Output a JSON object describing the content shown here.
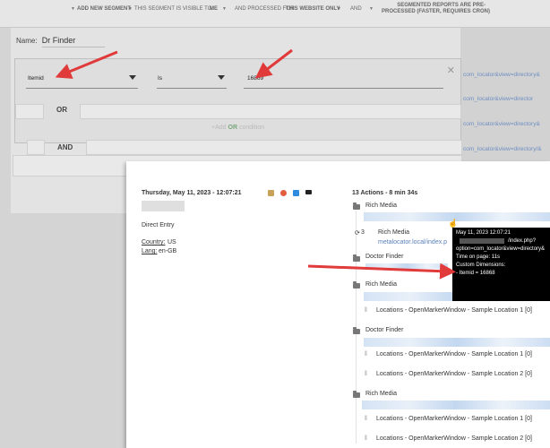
{
  "toolbar": {
    "add_segment": "ADD NEW SEGMENT",
    "visible_to_label": "THIS SEGMENT IS VISIBLE TO:",
    "visible_to_value": "ME",
    "processed_label": "AND PROCESSED FOR",
    "processed_value": "THIS WEBSITE ONLY",
    "and_label": "AND",
    "reports_line1": "SEGMENTED REPORTS ARE PRE-",
    "reports_line2": "PROCESSED (FASTER, REQUIRES CRON)"
  },
  "segment": {
    "name_label": "Name:",
    "name_value": "Dr Finder",
    "dimension": "Itemid",
    "operator": "Is",
    "value": "16869",
    "or_label": "OR",
    "add_or_prefix": "+Add ",
    "add_or_em": "OR",
    "add_or_suffix": " condition",
    "and_label": "AND"
  },
  "link_fragments": [
    "com_locator&view=directory&",
    "com_locator&view=director",
    "com_locator&view=directory&",
    "com_locator&view=directory/&"
  ],
  "visit": {
    "datetime": "Thursday, May 11, 2023 - 12:07:21",
    "referrer": "Direct Entry",
    "country_label": "Country:",
    "country": "US",
    "lang_label": "Lang:",
    "lang": "en-GB",
    "actions_summary": "13 Actions - 8 min 34s",
    "actions": [
      {
        "title": "Rich Media"
      },
      {
        "title": "Rich Media",
        "prefix": "3",
        "link": "metalocator.local/index.p"
      },
      {
        "title": "Doctor Finder"
      },
      {
        "title": "Rich Media"
      },
      {
        "event": "Locations - OpenMarkerWindow - Sample Location 1 [0]"
      },
      {
        "title": "Doctor Finder"
      },
      {
        "event": "Locations - OpenMarkerWindow - Sample Location 1 [0]"
      },
      {
        "event": "Locations - OpenMarkerWindow - Sample Location 2 [0]"
      },
      {
        "title": "Rich Media"
      },
      {
        "event": "Locations - OpenMarkerWindow - Sample Location 1 [0]"
      },
      {
        "event": "Locations - OpenMarkerWindow - Sample Location 2 [0]"
      }
    ]
  },
  "tooltip": {
    "line1": "May 11, 2023 12:07:21",
    "line2": "/index.php?",
    "line3": "option=com_locator&view=directory&",
    "line4": "Time on page: 11s",
    "line5": "Custom Dimensions:",
    "line6": "- Itemid = 16868"
  },
  "colors": {
    "arrow": "#e03a3a",
    "link": "#5a80b8",
    "add_or_green": "#7aa77a"
  }
}
